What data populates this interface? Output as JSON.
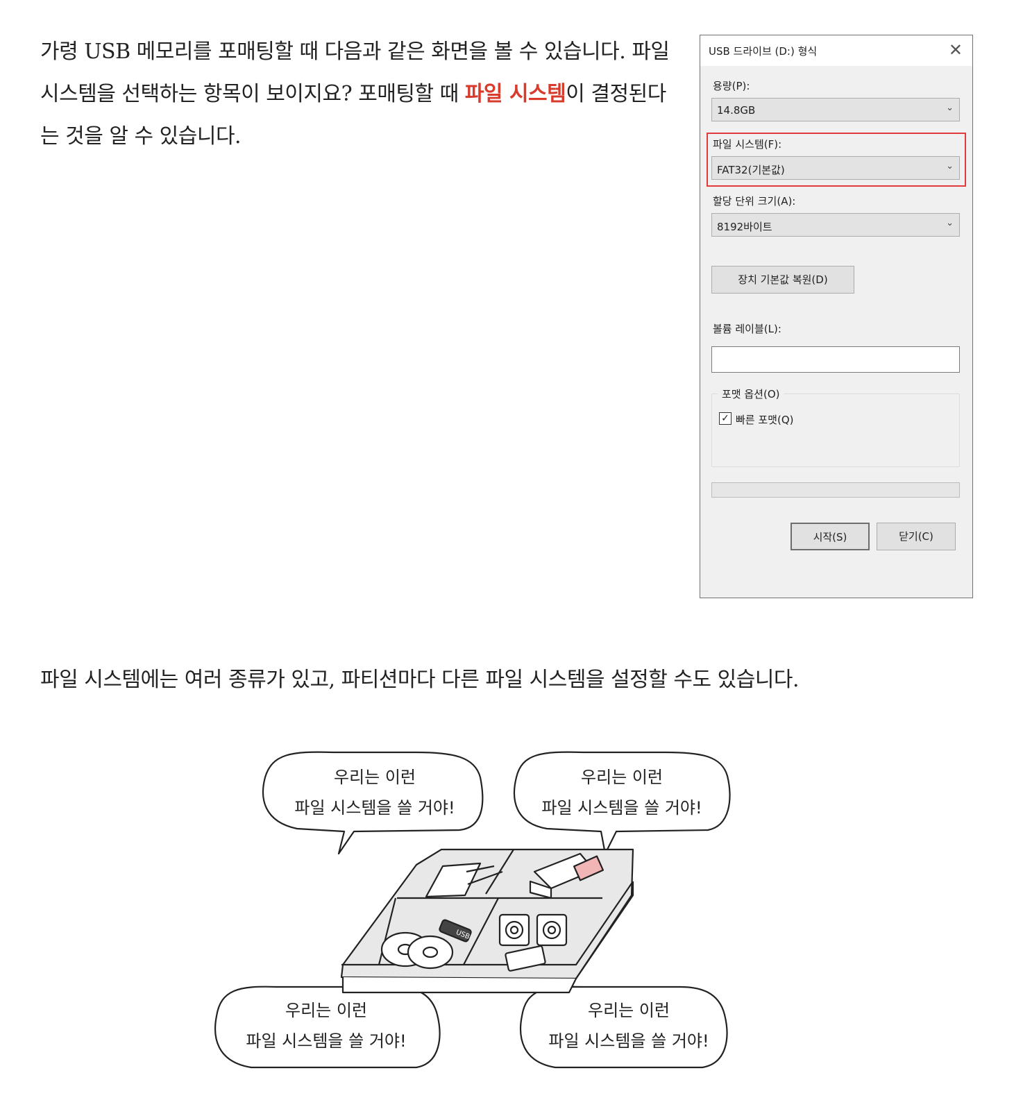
{
  "intro": {
    "text_before": "가령 USB 메모리를 포매팅할 때 다음과 같은 화면을 볼 수 있습니다. 파일 시스템을 선택하는 항목이 보이지요? 포매팅할 때 ",
    "highlight": "파일 시스템",
    "text_after": "이 결정된다는 것을 알 수 있습니다."
  },
  "dialog": {
    "title": "USB 드라이브 (D:) 형식",
    "close_glyph": "✕",
    "capacity_label": "용량(P):",
    "capacity_value": "14.8GB",
    "fs_label": "파일 시스템(F):",
    "fs_value": "FAT32(기본값)",
    "alloc_label": "할당 단위 크기(A):",
    "alloc_value": "8192바이트",
    "restore_button": "장치 기본값 복원(D)",
    "volume_label": "볼륨 레이블(L):",
    "volume_value": "",
    "format_options": "포맷 옵션(O)",
    "quick_format": "빠른 포맷(Q)",
    "quick_format_checked": true,
    "start_button": "시작(S)",
    "close_button": "닫기(C)",
    "highlight_color": "#e23a3a"
  },
  "second_paragraph": "파일 시스템에는 여러 종류가 있고, 파티션마다 다른 파일 시스템을 설정할 수도 있습니다.",
  "illustration": {
    "bubbles": [
      {
        "line1": "우리는 이런",
        "line2": "파일 시스템을 쓸 거야!"
      },
      {
        "line1": "우리는 이런",
        "line2": "파일 시스템을 쓸 거야!"
      },
      {
        "line1": "우리는 이런",
        "line2": "파일 시스템을 쓸 거야!"
      },
      {
        "line1": "우리는 이런",
        "line2": "파일 시스템을 쓸 거야!"
      }
    ],
    "usb_label": "USB"
  },
  "colors": {
    "accent": "#d83a2c",
    "dialog_bg": "#f0f0f0"
  }
}
